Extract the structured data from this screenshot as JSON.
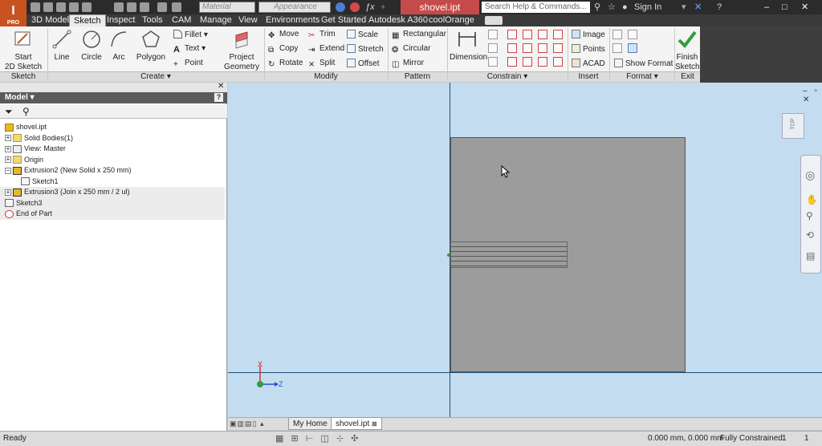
{
  "app": {
    "logo": "I",
    "edition": "PRO"
  },
  "title_bar": {
    "material_placeholder": "Material",
    "appearance_placeholder": "Appearance",
    "document_title": "shovel.ipt",
    "search_placeholder": "Search Help & Commands...",
    "sign_in": "Sign In"
  },
  "tabs": [
    "3D Model",
    "Sketch",
    "Inspect",
    "Tools",
    "CAM",
    "Manage",
    "View",
    "Environments",
    "Get Started",
    "Autodesk A360",
    "coolOrange"
  ],
  "ribbon": {
    "sketch": {
      "start_line1": "Start",
      "start_line2": "2D Sketch",
      "group": "Sketch"
    },
    "create": {
      "line": "Line",
      "circle": "Circle",
      "arc": "Arc",
      "polygon": "Polygon",
      "fillet": "Fillet",
      "text": "Text",
      "point": "Point",
      "project_line1": "Project",
      "project_line2": "Geometry",
      "group": "Create"
    },
    "modify": {
      "move": "Move",
      "trim": "Trim",
      "scale": "Scale",
      "copy": "Copy",
      "extend": "Extend",
      "stretch": "Stretch",
      "rotate": "Rotate",
      "split": "Split",
      "offset": "Offset",
      "group": "Modify"
    },
    "pattern": {
      "rectangular": "Rectangular",
      "circular": "Circular",
      "mirror": "Mirror",
      "group": "Pattern"
    },
    "constrain": {
      "dimension": "Dimension",
      "group": "Constrain"
    },
    "insert": {
      "image": "Image",
      "points": "Points",
      "acad": "ACAD",
      "group": "Insert"
    },
    "format": {
      "show_format": "Show Format",
      "group": "Format"
    },
    "exit": {
      "finish_line1": "Finish",
      "finish_line2": "Sketch",
      "group": "Exit"
    }
  },
  "browser": {
    "title": "Model",
    "tree": [
      {
        "label": "shovel.ipt",
        "icon": "part-icon"
      },
      {
        "label": "Solid Bodies(1)",
        "icon": "folder-icon"
      },
      {
        "label": "View: Master",
        "icon": "view-icon"
      },
      {
        "label": "Origin",
        "icon": "folder-icon"
      },
      {
        "label": "Extrusion2 (New Solid x 250 mm)",
        "icon": "extrusion-icon"
      },
      {
        "label": "Sketch1",
        "icon": "sketch-icon"
      },
      {
        "label": "Extrusion3 (Join x 250 mm / 2 ul)",
        "icon": "extrusion-icon"
      },
      {
        "label": "Sketch3",
        "icon": "sketch-icon"
      },
      {
        "label": "End of Part",
        "icon": "end-of-part-icon"
      }
    ]
  },
  "viewport": {
    "viewcube_label": "TOP",
    "axis_x": "X",
    "axis_z": "Z"
  },
  "doc_tabs": {
    "home": "My Home",
    "file": "shovel.ipt"
  },
  "status": {
    "left": "Ready",
    "coords": "0.000 mm, 0.000 mm",
    "constraint": "Fully Constrained",
    "count1": "1",
    "count2": "1"
  },
  "colors": {
    "app_orange": "#c9531f",
    "doc_title_red": "#c54a4a",
    "viewport_blue": "#c4dcf0",
    "part_gray": "#9c9c9c",
    "finish_green": "#2e9e3b"
  }
}
